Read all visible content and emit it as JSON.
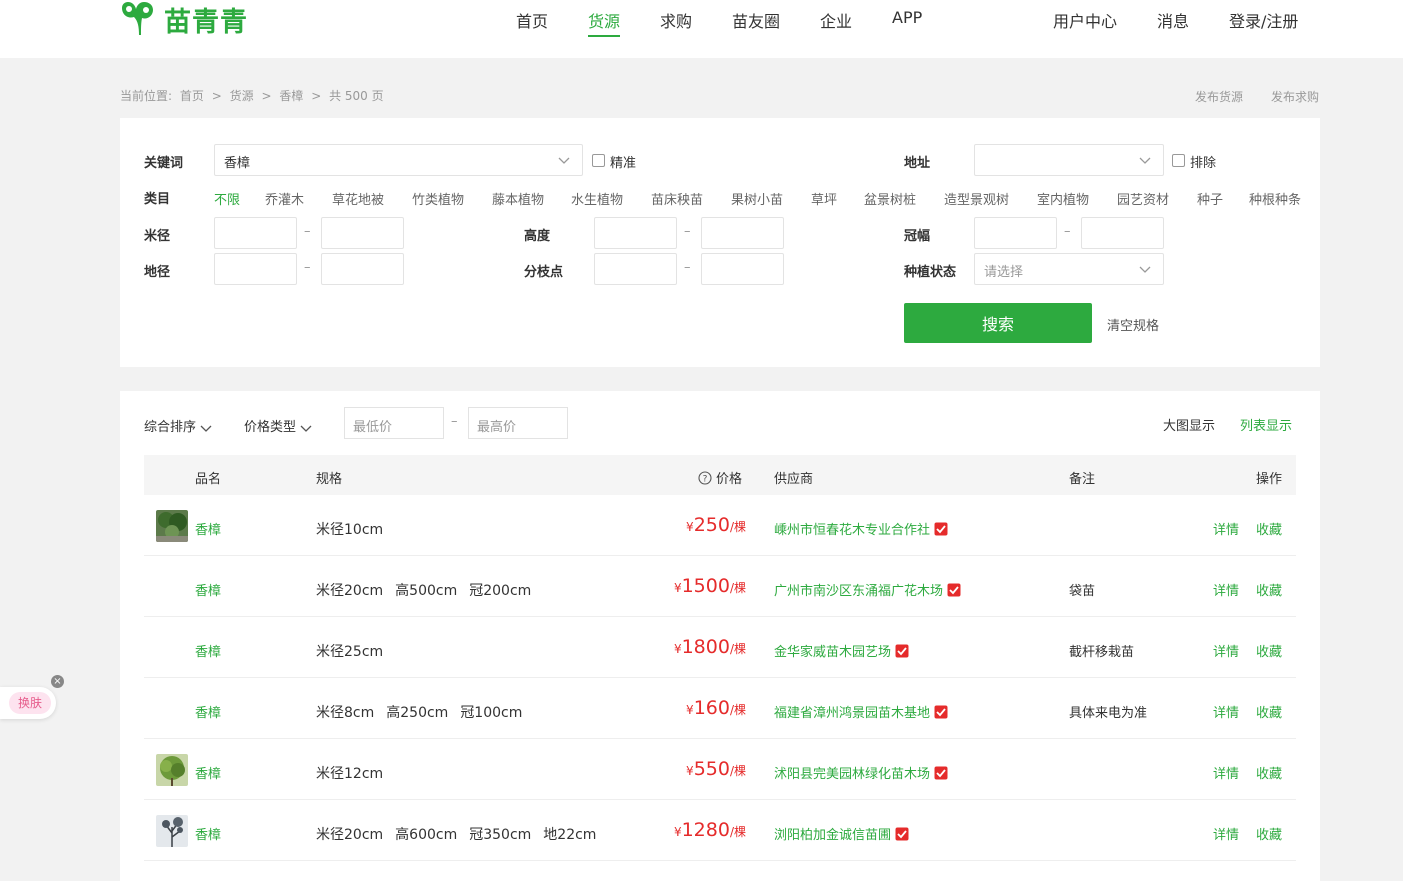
{
  "brand": {
    "name": "苗青青",
    "color": "#2daa3f"
  },
  "nav": {
    "items": [
      {
        "label": "首页",
        "active": false
      },
      {
        "label": "货源",
        "active": true
      },
      {
        "label": "求购",
        "active": false
      },
      {
        "label": "苗友圈",
        "active": false
      },
      {
        "label": "企业",
        "active": false
      },
      {
        "label": "APP",
        "active": false
      }
    ],
    "user_center": "用户中心",
    "messages": "消息",
    "login": "登录/注册"
  },
  "breadcrumb": {
    "prefix": "当前位置:",
    "items": [
      "首页",
      ">",
      "货源",
      ">",
      "香樟",
      ">",
      "共 500 页"
    ]
  },
  "top_links": {
    "publish_supply": "发布货源",
    "publish_demand": "发布求购"
  },
  "filters": {
    "keyword_label": "关键词",
    "keyword_value": "香樟",
    "exact_label": "精准",
    "address_label": "地址",
    "address_value": "",
    "exclude_label": "排除",
    "category_label": "类目",
    "categories": [
      "不限",
      "乔灌木",
      "草花地被",
      "竹类植物",
      "藤本植物",
      "水生植物",
      "苗床秧苗",
      "果树小苗",
      "草坪",
      "盆景树桩",
      "造型景观树",
      "室内植物",
      "园艺资材",
      "种子",
      "种根种条"
    ],
    "diameter_label": "米径",
    "height_label": "高度",
    "crown_label": "冠幅",
    "ground_diameter_label": "地径",
    "branch_label": "分枝点",
    "planting_label": "种植状态",
    "planting_placeholder": "请选择",
    "range_dash": "–",
    "search_button": "搜索",
    "clear_specs": "清空规格"
  },
  "toolbar": {
    "sort_label": "综合排序",
    "price_type_label": "价格类型",
    "min_price_placeholder": "最低价",
    "max_price_placeholder": "最高价",
    "range_dash": "–",
    "view_large": "大图显示",
    "view_list": "列表显示"
  },
  "table": {
    "headers": {
      "name": "品名",
      "spec": "规格",
      "price": "价格",
      "supplier": "供应商",
      "note": "备注",
      "action": "操作"
    },
    "price_currency": "¥",
    "price_unit": "/棵",
    "detail_label": "详情",
    "favorite_label": "收藏",
    "rows": [
      {
        "has_thumb": true,
        "name": "香樟",
        "specs": [
          "米径10cm"
        ],
        "price": "250",
        "supplier": "嵊州市恒春花木专业合作社",
        "note": ""
      },
      {
        "has_thumb": false,
        "name": "香樟",
        "specs": [
          "米径20cm",
          "高500cm",
          "冠200cm"
        ],
        "price": "1500",
        "supplier": "广州市南沙区东涌福广花木场",
        "note": "袋苗"
      },
      {
        "has_thumb": false,
        "name": "香樟",
        "specs": [
          "米径25cm"
        ],
        "price": "1800",
        "supplier": "金华家威苗木园艺场",
        "note": "截杆移栽苗"
      },
      {
        "has_thumb": false,
        "name": "香樟",
        "specs": [
          "米径8cm",
          "高250cm",
          "冠100cm"
        ],
        "price": "160",
        "supplier": "福建省漳州鸿景园苗木基地",
        "note": "具体来电为准"
      },
      {
        "has_thumb": true,
        "name": "香樟",
        "specs": [
          "米径12cm"
        ],
        "price": "550",
        "supplier": "沭阳县完美园林绿化苗木场",
        "note": ""
      },
      {
        "has_thumb": true,
        "name": "香樟",
        "specs": [
          "米径20cm",
          "高600cm",
          "冠350cm",
          "地22cm"
        ],
        "price": "1280",
        "supplier": "浏阳柏加金诚信苗圃",
        "note": ""
      }
    ]
  },
  "skin": {
    "label": "换肤",
    "close": "×"
  },
  "colors": {
    "accent": "#2daa3f",
    "price": "#e52b2b",
    "verify": "#e52b2b"
  }
}
